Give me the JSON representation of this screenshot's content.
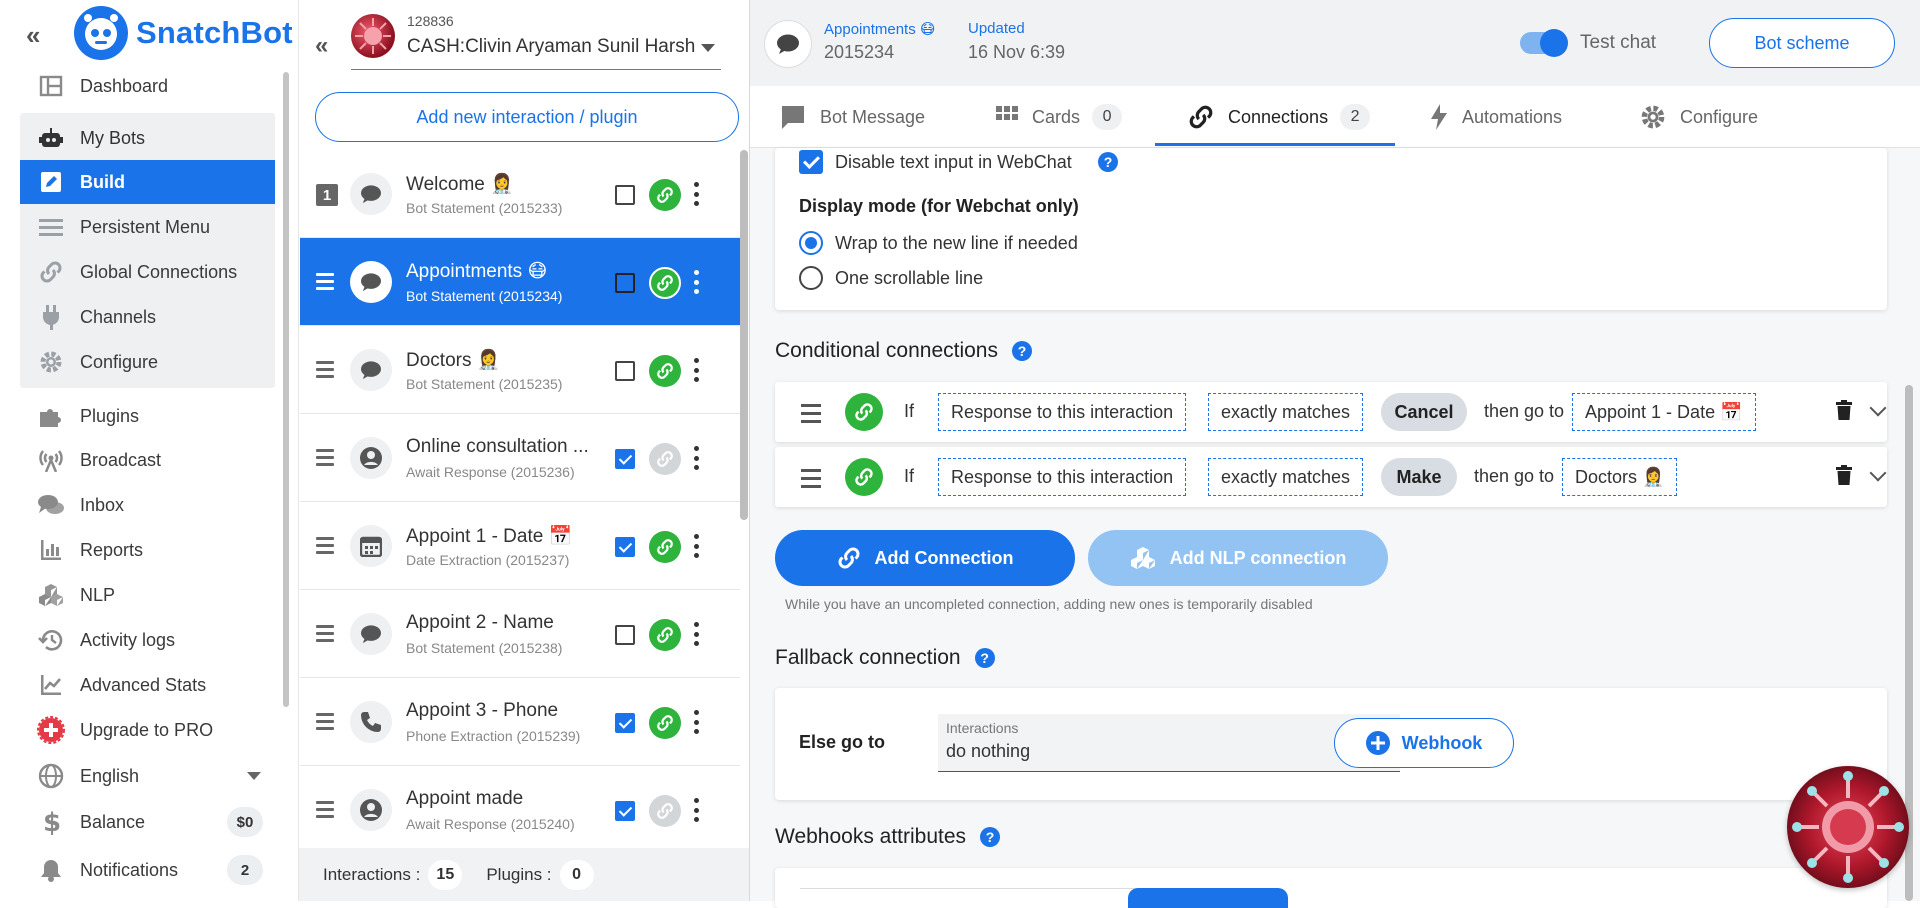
{
  "sidebar": {
    "brand": "SnatchBot",
    "collapse_glyph": "«",
    "items": [
      {
        "label": "Dashboard",
        "icon": "dashboard-icon"
      },
      {
        "label": "My Bots",
        "icon": "robot-icon"
      },
      {
        "label": "Build",
        "icon": "edit-icon"
      },
      {
        "label": "Persistent Menu",
        "icon": "menu-icon"
      },
      {
        "label": "Global Connections",
        "icon": "link-icon"
      },
      {
        "label": "Channels",
        "icon": "plug-icon"
      },
      {
        "label": "Configure",
        "icon": "gear-icon"
      },
      {
        "label": "Plugins",
        "icon": "puzzle-icon"
      },
      {
        "label": "Broadcast",
        "icon": "broadcast-icon"
      },
      {
        "label": "Inbox",
        "icon": "chat-icon"
      },
      {
        "label": "Reports",
        "icon": "bar-chart-icon"
      },
      {
        "label": "NLP",
        "icon": "cubes-icon"
      },
      {
        "label": "Activity logs",
        "icon": "history-icon"
      },
      {
        "label": "Advanced Stats",
        "icon": "trend-icon"
      },
      {
        "label": "Upgrade to PRO",
        "icon": "plus-badge-icon"
      },
      {
        "label": "English",
        "icon": "globe-icon"
      },
      {
        "label": "Balance",
        "icon": "dollar-icon",
        "badge": "$0"
      },
      {
        "label": "Notifications",
        "icon": "bell-icon",
        "badge": "2"
      }
    ]
  },
  "middle": {
    "collapse_glyph": "«",
    "bot_id": "128836",
    "bot_name": "CASH:Clivin Aryaman Sunil Harsh",
    "add_button": "Add new interaction / plugin",
    "interactions": [
      {
        "title": "Welcome 👩‍⚕️",
        "sub": "Bot Statement (2015233)",
        "num": "1",
        "checked": false,
        "linked": true,
        "icon": "chat-bubble-icon"
      },
      {
        "title": "Appointments 😷",
        "sub": "Bot Statement (2015234)",
        "checked": false,
        "linked": true,
        "icon": "chat-bubble-icon",
        "selected": true
      },
      {
        "title": "Doctors 👩‍⚕️",
        "sub": "Bot Statement (2015235)",
        "checked": false,
        "linked": true,
        "icon": "chat-bubble-icon"
      },
      {
        "title": "Online consultation ...",
        "sub": "Await Response (2015236)",
        "checked": true,
        "linked": false,
        "icon": "user-circle-icon"
      },
      {
        "title": "Appoint 1 - Date 📅",
        "sub": "Date Extraction (2015237)",
        "checked": true,
        "linked": true,
        "icon": "calendar-icon"
      },
      {
        "title": "Appoint 2 - Name",
        "sub": "Bot Statement (2015238)",
        "checked": false,
        "linked": true,
        "icon": "chat-bubble-icon"
      },
      {
        "title": "Appoint 3 - Phone",
        "sub": "Phone Extraction (2015239)",
        "checked": true,
        "linked": true,
        "icon": "phone-icon"
      },
      {
        "title": "Appoint made",
        "sub": "Await Response (2015240)",
        "checked": true,
        "linked": false,
        "icon": "user-circle-icon"
      }
    ],
    "footer": {
      "interactions_label": "Interactions :",
      "interactions_count": "15",
      "plugins_label": "Plugins :",
      "plugins_count": "0"
    }
  },
  "topbar": {
    "name": "Appointments 😷",
    "id": "2015234",
    "updated_label": "Updated",
    "updated_value": "16 Nov 6:39",
    "toggle_label": "Test chat",
    "bot_scheme": "Bot scheme"
  },
  "tabs": [
    {
      "label": "Bot Message",
      "icon": "message-icon"
    },
    {
      "label": "Cards",
      "icon": "grid-icon",
      "count": "0"
    },
    {
      "label": "Connections",
      "icon": "link-icon",
      "count": "2",
      "active": true
    },
    {
      "label": "Automations",
      "icon": "bolt-icon"
    },
    {
      "label": "Configure",
      "icon": "gear-icon"
    }
  ],
  "display": {
    "disable_text": "Disable text input in WebChat",
    "mode_title": "Display mode (for Webchat only)",
    "opt_wrap": "Wrap to the new line if needed",
    "opt_scroll": "One scrollable line"
  },
  "conditional": {
    "title": "Conditional connections",
    "rows": [
      {
        "if": "If",
        "field": "Response to this interaction",
        "op": "exactly matches",
        "value": "Cancel",
        "then": "then go to",
        "target": "Appoint 1 - Date 📅"
      },
      {
        "if": "If",
        "field": "Response to this interaction",
        "op": "exactly matches",
        "value": "Make",
        "then": "then go to",
        "target": "Doctors 👩‍⚕️"
      }
    ],
    "add_connection": "Add Connection",
    "add_nlp": "Add NLP connection",
    "note": "While you have an uncompleted connection, adding new ones is temporarily disabled"
  },
  "fallback": {
    "title": "Fallback connection",
    "else_label": "Else go to",
    "select_label": "Interactions",
    "select_value": "do nothing",
    "webhook": "Webhook"
  },
  "webhooks": {
    "title": "Webhooks attributes"
  },
  "colors": {
    "primary": "#1a73e8",
    "link_green": "#2eb33c",
    "disabled_blue": "#92c3f3"
  }
}
